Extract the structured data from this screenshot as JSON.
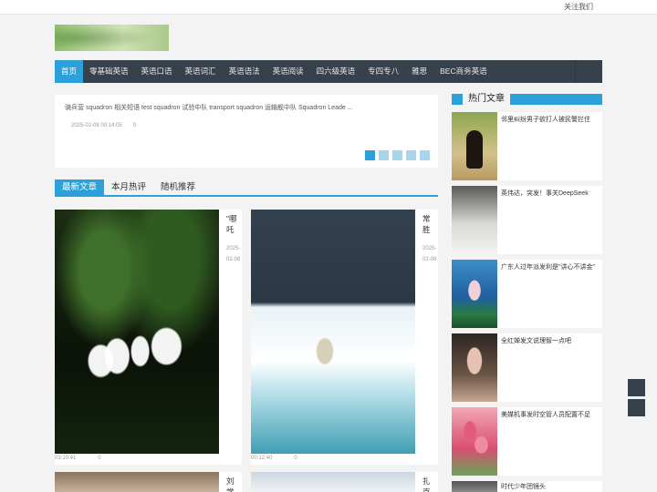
{
  "topbar": {
    "follow": "关注我们"
  },
  "nav": {
    "items": [
      "首页",
      "零基础英语",
      "英语口语",
      "英语词汇",
      "英语语法",
      "英语阅读",
      "四六级英语",
      "专四专八",
      "雅思",
      "BEC商务英语"
    ],
    "active_index": 0
  },
  "slider": {
    "headline": "骑兵营   squadron 相关短语   test squadron 试验中队  transport squadron 运输舰中队 Squadron Leade ...",
    "date": "2025-02-08 00:14:05",
    "count": "0",
    "slide_count": 5,
    "active_slide": 1
  },
  "tabs": [
    "最新文章",
    "本月热评",
    "随机推荐"
  ],
  "articles": [
    {
      "title": "\"哪吒",
      "date": "2025-02-08",
      "time": "03:10:41",
      "count": "0",
      "image": "white-jasmine-flowers"
    },
    {
      "title": "常胜",
      "date": "2025-02-08",
      "time": "00:12:40",
      "count": "0",
      "image": "polar-bear-on-ice"
    },
    {
      "title": "刘学",
      "image": "portrait"
    },
    {
      "title": "扎克",
      "image": "portrait-light"
    }
  ],
  "hot": {
    "heading": "热门文章",
    "items": [
      {
        "title": "邻里纠纷男子欲打人被民警拦住",
        "thumb": "dog"
      },
      {
        "title": "英伟达，突发！事关DeepSeek",
        "thumb": "bathroom"
      },
      {
        "title": "广东人过年派发利是\"讲心不讲金\"",
        "thumb": "lotus"
      },
      {
        "title": "全红婵发文说理智一点吧",
        "thumb": "portrait"
      },
      {
        "title": "美媒机事发时空管人员配置不足",
        "thumb": "tulips"
      },
      {
        "title": "时代少年团镜头",
        "thumb": "photo"
      }
    ]
  },
  "colors": {
    "accent": "#2ca0d8",
    "nav_bg": "#36414c",
    "page_bg": "#f3f3f3"
  }
}
